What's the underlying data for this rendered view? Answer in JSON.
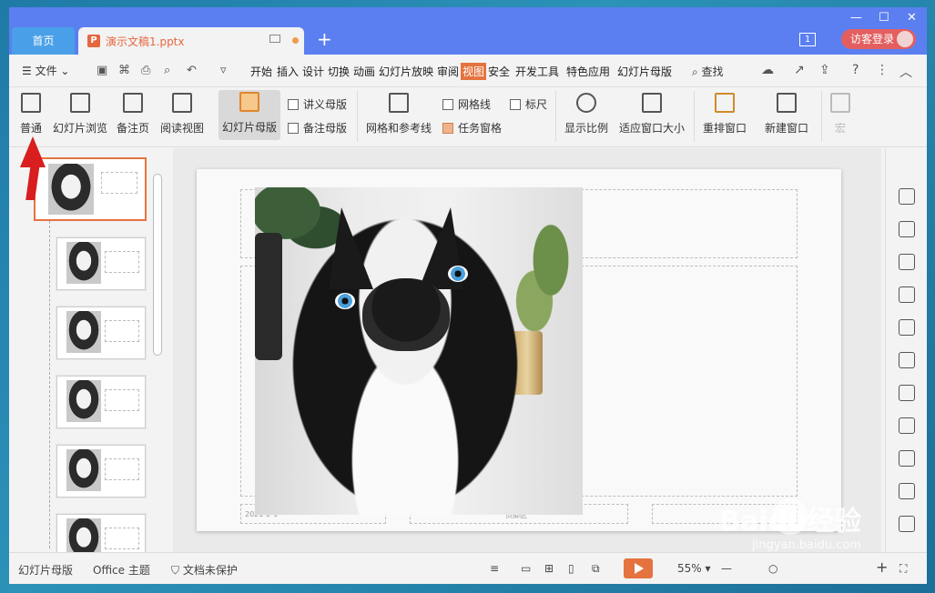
{
  "titlebar": {
    "home_tab": "首页",
    "doc_tab": "演示文稿1.pptx",
    "new_tab_symbol": "+",
    "page_badge": "1",
    "login_label": "访客登录"
  },
  "menubar": {
    "file_label": "文件",
    "tabs": [
      "开始",
      "插入",
      "设计",
      "切换",
      "动画",
      "幻灯片放映",
      "审阅",
      "视图",
      "安全",
      "开发工具",
      "特色应用",
      "幻灯片母版"
    ],
    "active_tab": "视图",
    "find_label": "查找"
  },
  "ribbon": {
    "normal": "普通",
    "slide_sorter": "幻灯片浏览",
    "notes_page": "备注页",
    "reading_view": "阅读视图",
    "slide_master": "幻灯片母版",
    "handout_master": "讲义母版",
    "notes_master": "备注母版",
    "grid_guides": "网格和参考线",
    "gridlines": "网格线",
    "ruler": "标尺",
    "task_pane": "任务窗格",
    "zoom": "显示比例",
    "fit_window": "适应窗口大小",
    "arrange_window": "重排窗口",
    "new_window": "新建窗口",
    "macro": "宏"
  },
  "slide": {
    "footer_date": "2021-2-1",
    "footer_mid": "页脚区"
  },
  "statusbar": {
    "mode": "幻灯片母版",
    "theme": "Office 主题",
    "protect": "文档未保护",
    "zoom": "55%"
  },
  "watermark": {
    "main": "Baidu经验",
    "sub": "jingyan.baidu.com"
  },
  "colors": {
    "titlebar": "#5b7ff0",
    "accent": "#e5733f",
    "arrow": "#d81e1e"
  }
}
